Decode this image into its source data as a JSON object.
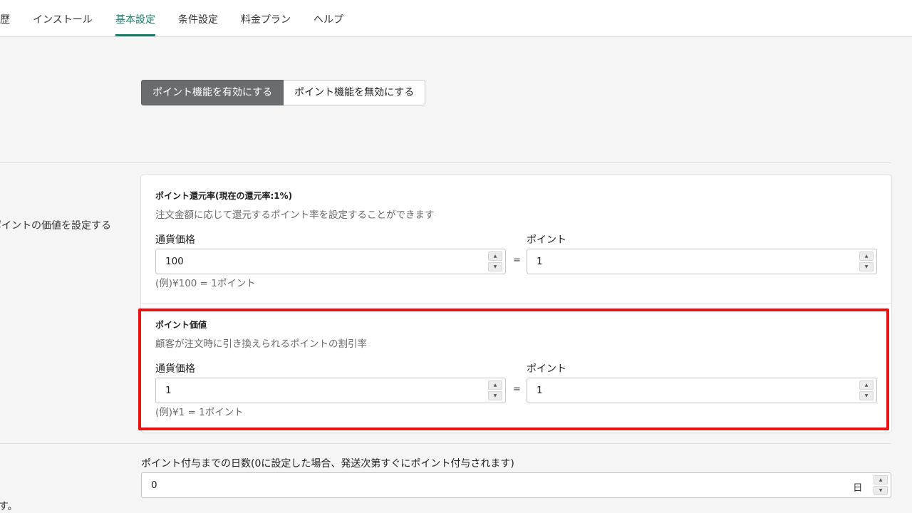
{
  "nav": {
    "tabs": [
      {
        "label": "歴"
      },
      {
        "label": "インストール"
      },
      {
        "label": "基本設定"
      },
      {
        "label": "条件設定"
      },
      {
        "label": "料金プラン"
      },
      {
        "label": "ヘルプ"
      }
    ],
    "active_tab": "基本設定"
  },
  "toggle": {
    "enable_label": "ポイント機能を有効にする",
    "disable_label": "ポイント機能を無効にする",
    "selected": "enable"
  },
  "section_left": {
    "point_value_desc": "ポイントの価値を設定する",
    "bottom_desc": "す。"
  },
  "reward_rate": {
    "title": "ポイント還元率(現在の還元率:1%)",
    "description": "注文金額に応じて還元するポイント率を設定することができます",
    "currency_label": "通貨価格",
    "currency_value": "100",
    "equals": "=",
    "point_label": "ポイント",
    "point_value": "1",
    "example": "(例)¥100 = 1ポイント"
  },
  "point_value": {
    "title": "ポイント価値",
    "description": "顧客が注文時に引き換えられるポイントの割引率",
    "currency_label": "通貨価格",
    "currency_value": "1",
    "equals": "=",
    "point_label": "ポイント",
    "point_value": "1",
    "example": "(例)¥1 = 1ポイント"
  },
  "grant_days": {
    "label": "ポイント付与までの日数(0に設定した場合、発送次第すぐにポイント付与されます)",
    "value": "0",
    "unit": "日"
  },
  "colors": {
    "accent": "#14806a",
    "highlight": "#ea1313",
    "active_button": "#6a6d70"
  }
}
